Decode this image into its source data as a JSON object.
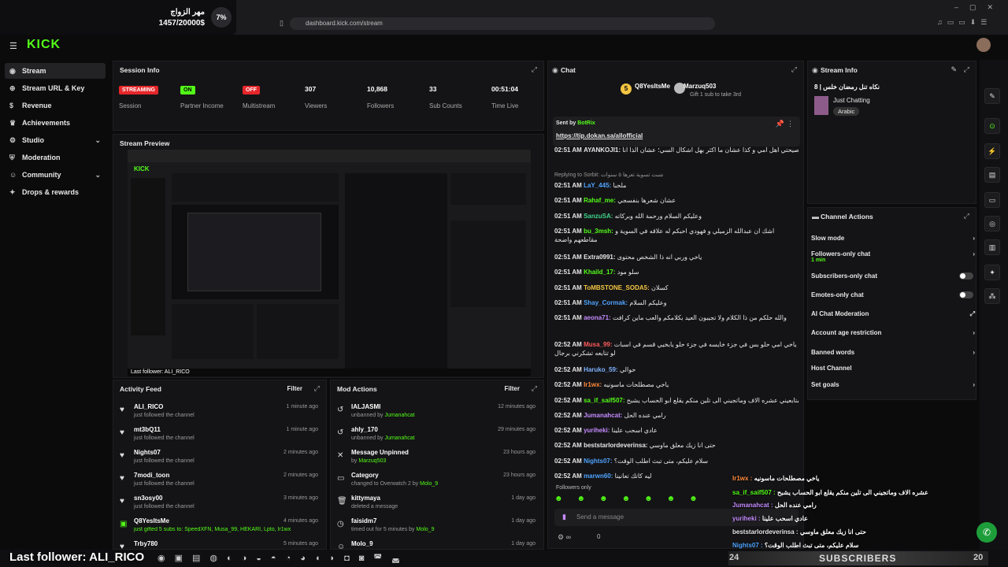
{
  "overlay": {
    "goal_title": "مهر الزواج",
    "goal_progress": "1457/20000$",
    "goal_percent": "7%"
  },
  "browser": {
    "url": "dashboard.kick.com/stream"
  },
  "brand": {
    "logo": "KICK",
    "accent": "#53fc18"
  },
  "sidebar": {
    "items": [
      {
        "label": "Stream",
        "icon": "radio-icon"
      },
      {
        "label": "Stream URL & Key",
        "icon": "globe-icon"
      },
      {
        "label": "Revenue",
        "icon": "dollar-icon"
      },
      {
        "label": "Achievements",
        "icon": "trophy-icon"
      },
      {
        "label": "Studio",
        "icon": "gear-icon"
      },
      {
        "label": "Moderation",
        "icon": "shield-icon"
      },
      {
        "label": "Community",
        "icon": "people-icon"
      },
      {
        "label": "Drops & rewards",
        "icon": "gift-icon"
      }
    ]
  },
  "session": {
    "title": "Session Info",
    "stats": [
      {
        "value": "STREAMING",
        "label": "Session"
      },
      {
        "value": "ON",
        "label": "Partner Income"
      },
      {
        "value": "OFF",
        "label": "Multistream"
      },
      {
        "value": "307",
        "label": "Viewers"
      },
      {
        "value": "10,868",
        "label": "Followers"
      },
      {
        "value": "33",
        "label": "Sub Counts"
      },
      {
        "value": "00:51:04",
        "label": "Time Live"
      }
    ]
  },
  "preview": {
    "title": "Stream Preview",
    "last_follower": "Last follower: ALI_RICO"
  },
  "activity": {
    "title": "Activity Feed",
    "filter": "Filter",
    "items": [
      {
        "name": "ALI_RICO",
        "sub": "just followed the channel",
        "time": "1 minute ago"
      },
      {
        "name": "mt3bQ11",
        "sub": "just followed the channel",
        "time": "1 minute ago"
      },
      {
        "name": "Nights07",
        "sub": "just followed the channel",
        "time": "2 minutes ago"
      },
      {
        "name": "7modi_toon",
        "sub": "just followed the channel",
        "time": "2 minutes ago"
      },
      {
        "name": "sn3osy00",
        "sub": "just followed the channel",
        "time": "3 minutes ago"
      },
      {
        "name": "Q8YesItsMe",
        "sub": "just gifted 5 subs to: SpeedXFN, Musa_99, HEKARI, Lpto, Ir1wx",
        "time": "4 minutes ago"
      },
      {
        "name": "Trby780",
        "sub": "",
        "time": "5 minutes ago"
      }
    ]
  },
  "mod": {
    "title": "Mod Actions",
    "filter": "Filter",
    "items": [
      {
        "name": "IALJASMI",
        "sub": "unbanned by",
        "by": "Jumanahcat",
        "time": "12 minutes ago"
      },
      {
        "name": "ahly_170",
        "sub": "unbanned by",
        "by": "Jumanahcat",
        "time": "29 minutes ago"
      },
      {
        "name": "Message Unpinned",
        "sub": "by",
        "by": "Marzuq503",
        "time": "23 hours ago"
      },
      {
        "name": "Category",
        "sub": "changed to Overwatch 2 by",
        "by": "Molo_9",
        "time": "23 hours ago"
      },
      {
        "name": "kittymaya",
        "sub": "deleted a message",
        "by": "",
        "time": "1 day ago"
      },
      {
        "name": "faisidm7",
        "sub": "timed out for 5 minutes by",
        "by": "Molo_9",
        "time": "1 day ago"
      },
      {
        "name": "Molo_9",
        "sub": "",
        "by": "",
        "time": "1 day ago"
      }
    ]
  },
  "chat": {
    "title": "Chat",
    "gifters": [
      {
        "name": "Q8YesItsMe",
        "count": "5"
      },
      {
        "name": "Marzuq503",
        "count": "1",
        "note": "Gift 1 sub to take 3rd"
      }
    ],
    "pinned": {
      "sent_by": "Sent by",
      "bot": "BotRix",
      "link": "https://tip.dokan.sa/allofficial"
    },
    "messages": [
      {
        "time": "02:51 AM",
        "user": "AYANKOJI1:",
        "color": "#e6e6e6",
        "text": "للمصيحتي اهل امي و كذا عشان ما اكثر بهل اشكال السي؛ عشان الذا انا"
      },
      {
        "time": "",
        "user": "",
        "color": "#9a9a9a",
        "text": "Replying to Sorbit: شبت تسوية تعرها ٥ سنوات"
      },
      {
        "time": "02:51 AM",
        "user": "LaY_445:",
        "color": "#4fa3ff",
        "text": "ملحبا"
      },
      {
        "time": "02:51 AM",
        "user": "Rahaf_me:",
        "color": "#53fc18",
        "text": "عشان شعرها بنفسجي"
      },
      {
        "time": "02:51 AM",
        "user": "SanzuSA:",
        "color": "#3fd48b",
        "text": "وعليكم السلام ورحمة الله وبركاته"
      },
      {
        "time": "02:51 AM",
        "user": "bu_3msh:",
        "color": "#53fc18",
        "text": "اشك ان عبدالله الزميلي و فهودي احبكم له علاقه في السوية و مقاطعهم واضحة"
      },
      {
        "time": "02:51 AM",
        "user": "Extra0991:",
        "color": "#e6e6e6",
        "text": "ياخي وربي انه ذا الشخص محتوى"
      },
      {
        "time": "02:51 AM",
        "user": "Khaild_17:",
        "color": "#53fc18",
        "text": "سلو مود"
      },
      {
        "time": "02:51 AM",
        "user": "ToMBSTONE_SODA5:",
        "color": "#f4c542",
        "text": "كسلان"
      },
      {
        "time": "02:51 AM",
        "user": "Shay_Cormak:",
        "color": "#4fa3ff",
        "text": "وعليكم السلام"
      },
      {
        "time": "02:51 AM",
        "user": "aeona71:",
        "color": "#c58cff",
        "text": "والله حلكم من ذا الكلام ولا تجيبون العيد بكلامكم والعب ماين كرافت"
      },
      {
        "time": "02:52 AM",
        "user": "Musa_99:",
        "color": "#ff5a5a",
        "text": "ياخي امي حلو بس في جزء خايسه في جزء حلو يابخيي قسم في اسبات لو تتابعه تشكرني برجال"
      },
      {
        "time": "02:52 AM",
        "user": "Haruko_59:",
        "color": "#7fb2ff",
        "text": "حوالي"
      },
      {
        "time": "02:52 AM",
        "user": "Ir1wx:",
        "color": "#ff8a3d",
        "text": "ياخي مصطلحات ماسونيه"
      },
      {
        "time": "02:52 AM",
        "user": "sa_if_saif507:",
        "color": "#53fc18",
        "text": "متابعيني عشره الاف وماتجيني الى تلين منكم يقلع ابو الحساب يشبح"
      },
      {
        "time": "02:52 AM",
        "user": "Jumanahcat:",
        "color": "#c58cff",
        "text": "رامي عنده الحل"
      },
      {
        "time": "02:52 AM",
        "user": "yuriheki:",
        "color": "#c58cff",
        "text": "عادي اسحب علينا"
      },
      {
        "time": "02:52 AM",
        "user": "beststarlordeverinsa:",
        "color": "#e6e6e6",
        "text": "حتى انا زيك معلق ماوسي"
      },
      {
        "time": "02:52 AM",
        "user": "Nights07:",
        "color": "#4fa3ff",
        "text": "سلام عليكم، متى تبث اطلب الوقت؟"
      },
      {
        "time": "02:52 AM",
        "user": "marwn60:",
        "color": "#4fa3ff",
        "text": "ليه كاتك تعانينا"
      }
    ],
    "followers_only": "Followers only",
    "placeholder": "Send a message",
    "count": "0"
  },
  "stream_info": {
    "title": "Stream Info",
    "stream_title": "نكاه تنل رمضان خلس | 8",
    "category": "Just Chatting",
    "tag": "Arabic"
  },
  "channel_actions": {
    "title": "Channel Actions",
    "items": [
      {
        "label": "Slow mode",
        "control": "chevron"
      },
      {
        "label": "Followers-only chat",
        "sub": "1 min",
        "control": "chevron"
      },
      {
        "label": "Subscribers-only chat",
        "control": "toggle"
      },
      {
        "label": "Emotes-only chat",
        "control": "toggle"
      },
      {
        "label": "AI Chat Moderation",
        "control": "external"
      },
      {
        "label": "Account age restriction",
        "control": "chevron"
      },
      {
        "label": "Banned words",
        "control": "chevron"
      },
      {
        "label": "Host Channel",
        "control": "none"
      },
      {
        "label": "Set goals",
        "control": "chevron"
      }
    ]
  },
  "stream_overlay": {
    "lines": [
      {
        "user": "Ir1wx :",
        "color": "#ff8a3d",
        "text": "ياخي مصطلحات ماسونيه"
      },
      {
        "user": "sa_if_saif507 :",
        "color": "#53fc18",
        "text": "متابعيني عشره الاف وماتجيني الى تلين منكم يقلع ابو الحساب يشبح"
      },
      {
        "user": "Jumanahcat :",
        "color": "#c58cff",
        "text": "رامي عنده الحل"
      },
      {
        "user": "yuriheki :",
        "color": "#c58cff",
        "text": "عادي اسحب علينا"
      },
      {
        "user": "beststarlordeverinsa :",
        "color": "#e6e6e6",
        "text": "حتى انا زيك معلق ماوسي"
      },
      {
        "user": "Nights07 :",
        "color": "#4fa3ff",
        "text": "سلام عليكم، متى تبث اطلب الوقت؟"
      },
      {
        "user": "marwn60 :",
        "color": "#4fa3ff",
        "text": "ليه كاتك تعانينا"
      }
    ],
    "subs_label": "SUBSCRIBERS",
    "subs_count": "20",
    "subs_left": "24"
  }
}
